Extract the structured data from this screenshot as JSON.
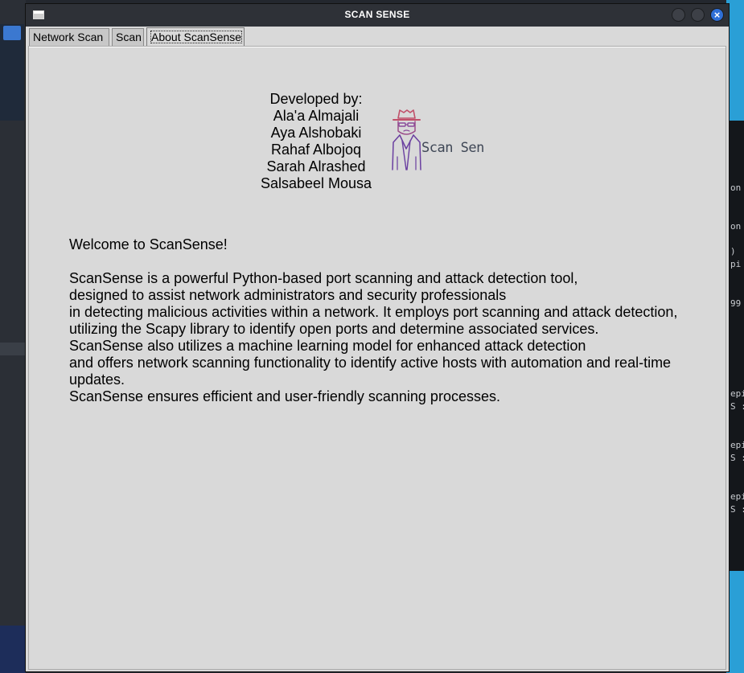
{
  "window": {
    "title": "SCAN SENSE"
  },
  "tabs": [
    {
      "label": "Network Scan"
    },
    {
      "label": "Scan"
    },
    {
      "label": "About ScanSense",
      "selected": true
    }
  ],
  "about": {
    "developed_by": "Developed by:",
    "developers": [
      "Ala'a Almajali",
      "Aya Alshobaki",
      "Rahaf Albojoq",
      "Sarah Alrashed",
      "Salsabeel Mousa"
    ],
    "logo_text": "Scan Sense",
    "welcome": "Welcome to ScanSense!",
    "description_lines": [
      "ScanSense is a powerful Python-based port scanning and attack detection tool,",
      "designed to assist network administrators and security professionals",
      "in detecting malicious activities within a network. It employs port scanning and attack detection,",
      "utilizing the Scapy library to identify open ports and determine associated services.",
      "ScanSense also utilizes a machine learning model for enhanced attack detection",
      "and offers network scanning functionality to identify active hosts with automation and real-time",
      "updates.",
      "ScanSense ensures efficient and user-friendly scanning processes."
    ]
  },
  "background_terminal": {
    "lines": [
      "on",
      "on",
      ")",
      "pi",
      "99",
      "epi",
      "S :",
      "epi",
      "S :",
      "epi",
      "S :"
    ]
  },
  "colors": {
    "panel_bg": "#d9d9d9",
    "titlebar_bg": "#2e3137",
    "close_button": "#2f6fd6",
    "logo_hat": "#c0506a",
    "logo_body": "#6a3fa0"
  }
}
